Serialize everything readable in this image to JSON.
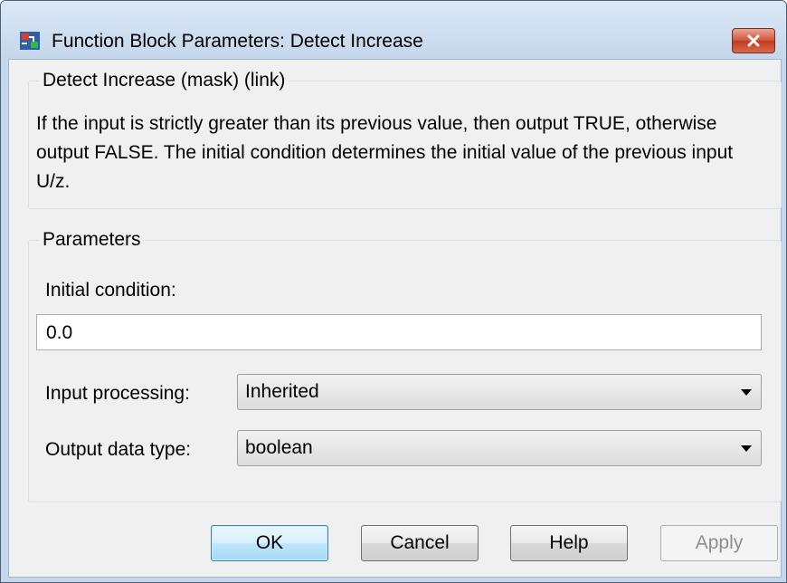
{
  "window": {
    "title": "Function Block Parameters: Detect Increase",
    "close_icon": "close-icon"
  },
  "description_group": {
    "legend": "Detect Increase (mask) (link)",
    "text": "If the input is strictly greater than its previous value, then output TRUE, otherwise output FALSE.  The initial condition determines the initial value of the previous input U/z."
  },
  "parameters_group": {
    "legend": "Parameters",
    "initial_condition": {
      "label": "Initial condition:",
      "value": "0.0"
    },
    "input_processing": {
      "label": "Input processing:",
      "value": "Inherited"
    },
    "output_data_type": {
      "label": "Output data type:",
      "value": "boolean"
    }
  },
  "buttons": {
    "ok": "OK",
    "cancel": "Cancel",
    "help": "Help",
    "apply": "Apply"
  }
}
